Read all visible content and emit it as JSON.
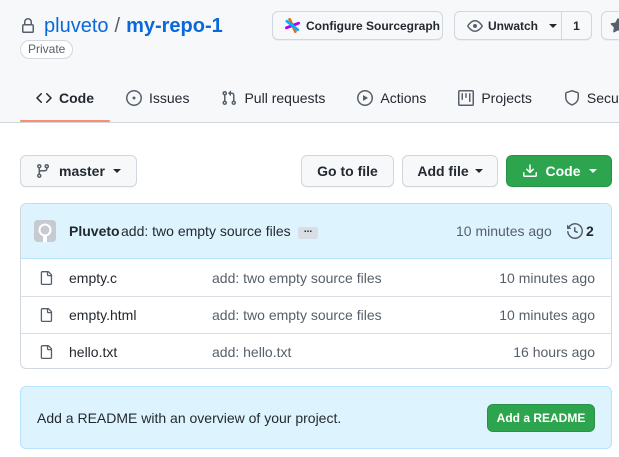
{
  "repo": {
    "owner": "pluveto",
    "separator": "/",
    "name": "my-repo-1",
    "visibility": "Private"
  },
  "header_buttons": {
    "sourcegraph_label": "Configure Sourcegraph",
    "watch_label": "Unwatch",
    "watch_count": "1"
  },
  "tabs": [
    {
      "label": "Code",
      "icon": "code-icon",
      "active": true
    },
    {
      "label": "Issues",
      "icon": "issue-icon",
      "active": false
    },
    {
      "label": "Pull requests",
      "icon": "pull-request-icon",
      "active": false
    },
    {
      "label": "Actions",
      "icon": "play-icon",
      "active": false
    },
    {
      "label": "Projects",
      "icon": "table-icon",
      "active": false
    },
    {
      "label": "Security",
      "icon": "shield-icon",
      "active": false
    }
  ],
  "toolbar": {
    "branch": "master",
    "go_to_file": "Go to file",
    "add_file": "Add file",
    "code": "Code"
  },
  "latest_commit": {
    "author": "Pluveto",
    "message": "add: two empty source files",
    "ellipsis": "...",
    "time": "10 minutes ago",
    "commit_count": "2"
  },
  "files": [
    {
      "name": "empty.c",
      "message": "add: two empty source files",
      "time": "10 minutes ago"
    },
    {
      "name": "empty.html",
      "message": "add: two empty source files",
      "time": "10 minutes ago"
    },
    {
      "name": "hello.txt",
      "message": "add: hello.txt",
      "time": "16 hours ago"
    }
  ],
  "readme_banner": {
    "text": "Add a README with an overview of your project.",
    "button": "Add a README"
  },
  "colors": {
    "link": "#0969da",
    "primary_button": "#2da44e",
    "active_tab_underline": "#fd8c73",
    "info_background": "#ddf4ff"
  }
}
